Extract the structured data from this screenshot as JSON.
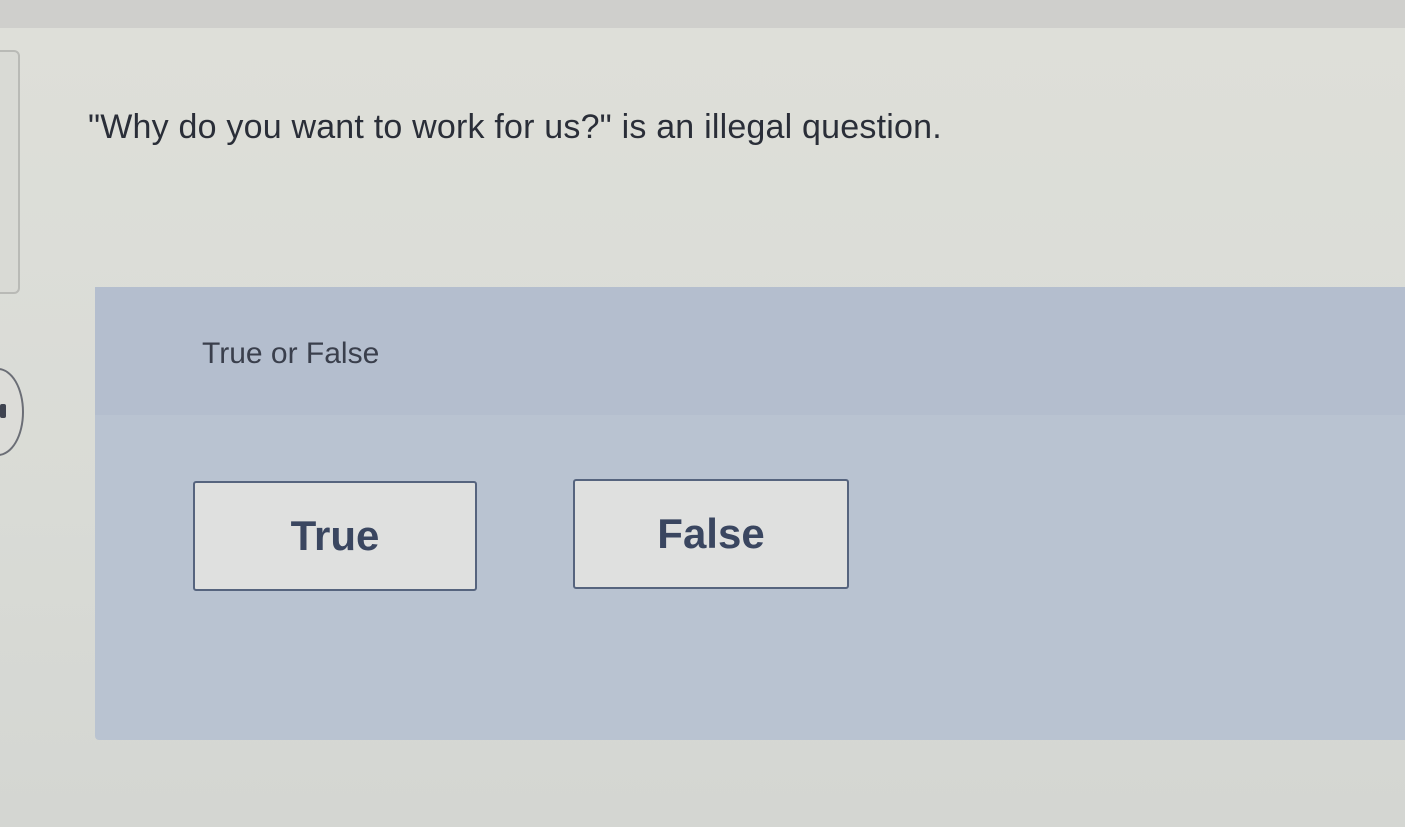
{
  "question": {
    "text": "\"Why do you want to work for us?\" is an illegal question."
  },
  "answer_area": {
    "prompt": "True or False",
    "choices": [
      {
        "label": "True"
      },
      {
        "label": "False"
      }
    ]
  },
  "colors": {
    "page_background": "#d9dbd6",
    "panel_background": "#b9c3d1",
    "button_background": "#dfe0df",
    "button_border": "#56647e",
    "button_text": "#3a4660",
    "question_text": "#2a2e38"
  }
}
